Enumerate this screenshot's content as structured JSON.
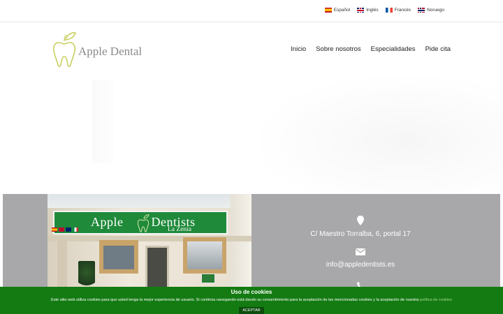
{
  "languages": [
    {
      "label": "Español",
      "flag": "flag-es"
    },
    {
      "label": "Inglés",
      "flag": "flag-en"
    },
    {
      "label": "Francés",
      "flag": "flag-fr"
    },
    {
      "label": "Noruego",
      "flag": "flag-no"
    }
  ],
  "logo": {
    "text": "Apple Dental",
    "icon": "apple-tooth-icon",
    "color": "#c9cf5e"
  },
  "nav": {
    "inicio": "Inicio",
    "sobre": "Sobre nosotros",
    "especialidades": "Especialidades",
    "cita": "Pide cita"
  },
  "photo": {
    "sign_title": "Apple        Dentists",
    "sign_sub": "La Zenia"
  },
  "contact": {
    "address": "C/ Maestro Torralba, 6, portal 17",
    "email": "info@appledentists.es",
    "icons": [
      "map-marker-icon",
      "envelope-icon",
      "phone-icon"
    ]
  },
  "cookie": {
    "title": "Uso de cookies",
    "text": "Este sitio web utiliza cookies para que usted tenga la mejor experiencia de usuario. Si continúa navegando está dando su consentimiento para la aceptación de las mencionadas cookies y la aceptación de nuestra ",
    "link": "política de cookies",
    "button": "ACEPTAR"
  },
  "colors": {
    "info_bg": "#a8a8aa",
    "cookie_bg": "#147b13",
    "sign_green": "#1f8a3a"
  }
}
